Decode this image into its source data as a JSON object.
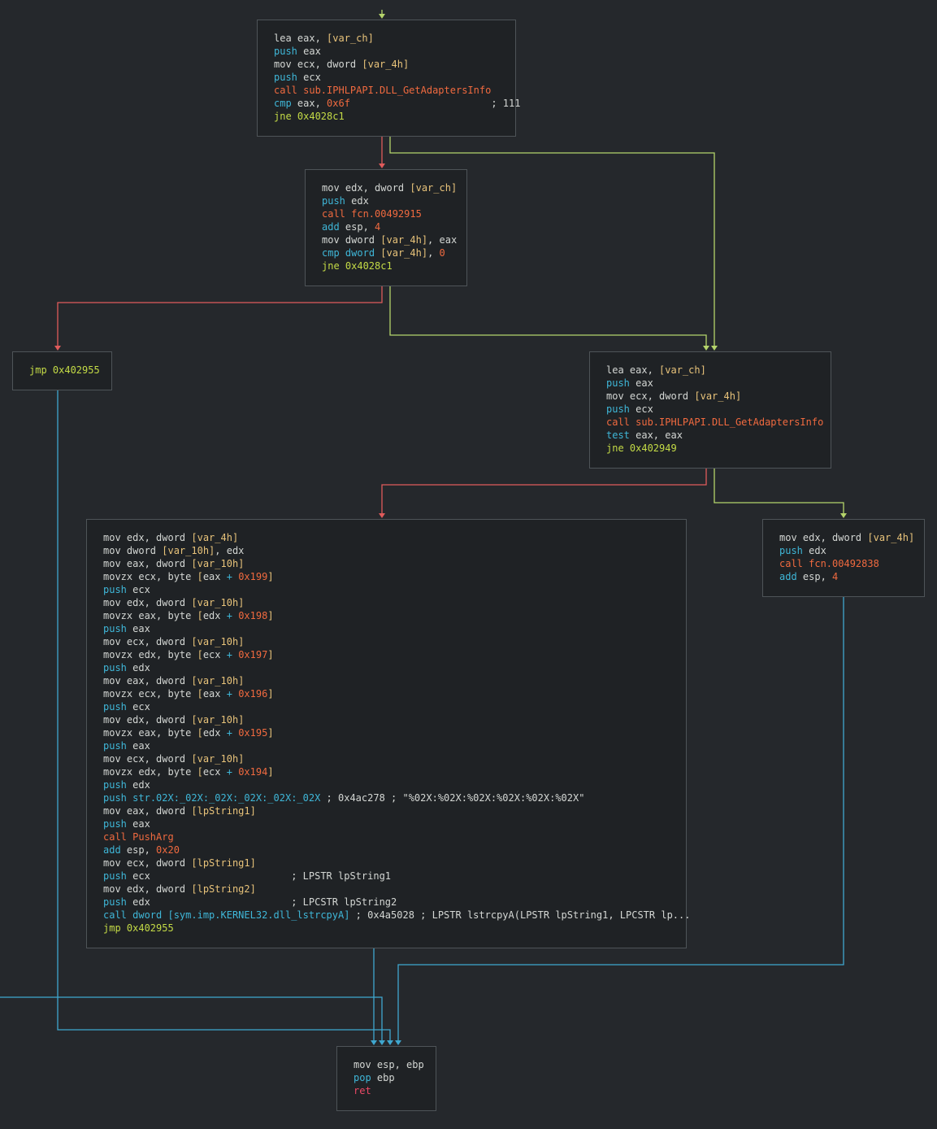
{
  "colors": {
    "background": "#25282c",
    "block_bg": "#1f2225",
    "block_border": "#4e5458",
    "edge_true": "#b5d46b",
    "edge_false": "#e05b5b",
    "edge_uncond": "#3fa7cf",
    "text": "#d4d7d4",
    "push_pop": "#3fb7d8",
    "call": "#f06a3f",
    "jump": "#c4db46",
    "var": "#e8c37a",
    "ret": "#ec4a66"
  },
  "blocks": [
    {
      "id": "b1",
      "lines": [
        [
          [
            "t-plain",
            "lea eax, "
          ],
          [
            "t-var",
            "[var_ch]"
          ]
        ],
        [
          [
            "t-push",
            "push"
          ],
          [
            "t-plain",
            " eax"
          ]
        ],
        [
          [
            "t-plain",
            "mov ecx, dword "
          ],
          [
            "t-var",
            "[var_4h]"
          ]
        ],
        [
          [
            "t-push",
            "push"
          ],
          [
            "t-plain",
            " ecx"
          ]
        ],
        [
          [
            "t-call",
            "call sub.IPHLPAPI.DLL_GetAdaptersInfo"
          ]
        ],
        [
          [
            "t-push",
            "cmp"
          ],
          [
            "t-plain",
            " eax, "
          ],
          [
            "t-num",
            "0x6f"
          ],
          [
            "t-cmt",
            "                        ; 111"
          ]
        ],
        [
          [
            "t-jmp",
            "jne 0x4028c1"
          ]
        ]
      ]
    },
    {
      "id": "b2",
      "lines": [
        [
          [
            "t-plain",
            "mov edx, dword "
          ],
          [
            "t-var",
            "[var_ch]"
          ]
        ],
        [
          [
            "t-push",
            "push"
          ],
          [
            "t-plain",
            " edx"
          ]
        ],
        [
          [
            "t-call",
            "call fcn.00492915"
          ]
        ],
        [
          [
            "t-push",
            "add"
          ],
          [
            "t-plain",
            " esp, "
          ],
          [
            "t-num",
            "4"
          ]
        ],
        [
          [
            "t-plain",
            "mov dword "
          ],
          [
            "t-var",
            "[var_4h]"
          ],
          [
            "t-plain",
            ", eax"
          ]
        ],
        [
          [
            "t-push",
            "cmp"
          ],
          [
            "t-plain",
            " "
          ],
          [
            "t-push",
            "dword"
          ],
          [
            "t-plain",
            " "
          ],
          [
            "t-var",
            "[var_4h]"
          ],
          [
            "t-plain",
            ", "
          ],
          [
            "t-num",
            "0"
          ]
        ],
        [
          [
            "t-jmp",
            "jne 0x4028c1"
          ]
        ]
      ]
    },
    {
      "id": "b3",
      "lines": [
        [
          [
            "t-jmp",
            "jmp 0x402955"
          ]
        ]
      ]
    },
    {
      "id": "b4",
      "lines": [
        [
          [
            "t-plain",
            "lea eax, "
          ],
          [
            "t-var",
            "[var_ch]"
          ]
        ],
        [
          [
            "t-push",
            "push"
          ],
          [
            "t-plain",
            " eax"
          ]
        ],
        [
          [
            "t-plain",
            "mov ecx, dword "
          ],
          [
            "t-var",
            "[var_4h]"
          ]
        ],
        [
          [
            "t-push",
            "push"
          ],
          [
            "t-plain",
            " ecx"
          ]
        ],
        [
          [
            "t-call",
            "call sub.IPHLPAPI.DLL_GetAdaptersInfo"
          ]
        ],
        [
          [
            "t-push",
            "test"
          ],
          [
            "t-plain",
            " eax, eax"
          ]
        ],
        [
          [
            "t-jmp",
            "jne 0x402949"
          ]
        ]
      ]
    },
    {
      "id": "b5",
      "lines": [
        [
          [
            "t-plain",
            "mov edx, dword "
          ],
          [
            "t-var",
            "[var_4h]"
          ]
        ],
        [
          [
            "t-plain",
            "mov dword "
          ],
          [
            "t-var",
            "[var_10h]"
          ],
          [
            "t-plain",
            ", edx"
          ]
        ],
        [
          [
            "t-plain",
            "mov eax, dword "
          ],
          [
            "t-var",
            "[var_10h]"
          ]
        ],
        [
          [
            "t-plain",
            "movzx ecx, byte "
          ],
          [
            "t-var",
            "["
          ],
          [
            "t-plain",
            "eax "
          ],
          [
            "t-push",
            "+"
          ],
          [
            "t-plain",
            " "
          ],
          [
            "t-num",
            "0x199"
          ],
          [
            "t-var",
            "]"
          ]
        ],
        [
          [
            "t-push",
            "push"
          ],
          [
            "t-plain",
            " ecx"
          ]
        ],
        [
          [
            "t-plain",
            "mov edx, dword "
          ],
          [
            "t-var",
            "[var_10h]"
          ]
        ],
        [
          [
            "t-plain",
            "movzx eax, byte "
          ],
          [
            "t-var",
            "["
          ],
          [
            "t-plain",
            "edx "
          ],
          [
            "t-push",
            "+"
          ],
          [
            "t-plain",
            " "
          ],
          [
            "t-num",
            "0x198"
          ],
          [
            "t-var",
            "]"
          ]
        ],
        [
          [
            "t-push",
            "push"
          ],
          [
            "t-plain",
            " eax"
          ]
        ],
        [
          [
            "t-plain",
            "mov ecx, dword "
          ],
          [
            "t-var",
            "[var_10h]"
          ]
        ],
        [
          [
            "t-plain",
            "movzx edx, byte "
          ],
          [
            "t-var",
            "["
          ],
          [
            "t-plain",
            "ecx "
          ],
          [
            "t-push",
            "+"
          ],
          [
            "t-plain",
            " "
          ],
          [
            "t-num",
            "0x197"
          ],
          [
            "t-var",
            "]"
          ]
        ],
        [
          [
            "t-push",
            "push"
          ],
          [
            "t-plain",
            " edx"
          ]
        ],
        [
          [
            "t-plain",
            "mov eax, dword "
          ],
          [
            "t-var",
            "[var_10h]"
          ]
        ],
        [
          [
            "t-plain",
            "movzx ecx, byte "
          ],
          [
            "t-var",
            "["
          ],
          [
            "t-plain",
            "eax "
          ],
          [
            "t-push",
            "+"
          ],
          [
            "t-plain",
            " "
          ],
          [
            "t-num",
            "0x196"
          ],
          [
            "t-var",
            "]"
          ]
        ],
        [
          [
            "t-push",
            "push"
          ],
          [
            "t-plain",
            " ecx"
          ]
        ],
        [
          [
            "t-plain",
            "mov edx, dword "
          ],
          [
            "t-var",
            "[var_10h]"
          ]
        ],
        [
          [
            "t-plain",
            "movzx eax, byte "
          ],
          [
            "t-var",
            "["
          ],
          [
            "t-plain",
            "edx "
          ],
          [
            "t-push",
            "+"
          ],
          [
            "t-plain",
            " "
          ],
          [
            "t-num",
            "0x195"
          ],
          [
            "t-var",
            "]"
          ]
        ],
        [
          [
            "t-push",
            "push"
          ],
          [
            "t-plain",
            " eax"
          ]
        ],
        [
          [
            "t-plain",
            "mov ecx, dword "
          ],
          [
            "t-var",
            "[var_10h]"
          ]
        ],
        [
          [
            "t-plain",
            "movzx edx, byte "
          ],
          [
            "t-var",
            "["
          ],
          [
            "t-plain",
            "ecx "
          ],
          [
            "t-push",
            "+"
          ],
          [
            "t-plain",
            " "
          ],
          [
            "t-num",
            "0x194"
          ],
          [
            "t-var",
            "]"
          ]
        ],
        [
          [
            "t-push",
            "push"
          ],
          [
            "t-plain",
            " edx"
          ]
        ],
        [
          [
            "t-push",
            "push"
          ],
          [
            "t-plain",
            " "
          ],
          [
            "t-str",
            "str.02X:_02X:_02X:_02X:_02X:_02X"
          ],
          [
            "t-cmt",
            " ; 0x4ac278 ; \"%02X:%02X:%02X:%02X:%02X:%02X\""
          ]
        ],
        [
          [
            "t-plain",
            "mov eax, dword "
          ],
          [
            "t-var",
            "[lpString1]"
          ]
        ],
        [
          [
            "t-push",
            "push"
          ],
          [
            "t-plain",
            " eax"
          ]
        ],
        [
          [
            "t-call",
            "call PushArg"
          ]
        ],
        [
          [
            "t-push",
            "add"
          ],
          [
            "t-plain",
            " esp, "
          ],
          [
            "t-num",
            "0x20"
          ]
        ],
        [
          [
            "t-plain",
            "mov ecx, dword "
          ],
          [
            "t-var",
            "[lpString1]"
          ]
        ],
        [
          [
            "t-push",
            "push"
          ],
          [
            "t-plain",
            " ecx"
          ],
          [
            "t-cmt",
            "                        ; LPSTR lpString1"
          ]
        ],
        [
          [
            "t-plain",
            "mov edx, dword "
          ],
          [
            "t-var",
            "[lpString2]"
          ]
        ],
        [
          [
            "t-push",
            "push"
          ],
          [
            "t-plain",
            " edx"
          ],
          [
            "t-cmt",
            "                        ; LPCSTR lpString2"
          ]
        ],
        [
          [
            "t-push",
            "call dword "
          ],
          [
            "t-str",
            "[sym.imp.KERNEL32.dll_lstrcpyA]"
          ],
          [
            "t-cmt",
            " ; 0x4a5028 ; LPSTR lstrcpyA(LPSTR lpString1, LPCSTR lp..."
          ]
        ],
        [
          [
            "t-jmp",
            "jmp 0x402955"
          ]
        ]
      ]
    },
    {
      "id": "b6",
      "lines": [
        [
          [
            "t-plain",
            "mov edx, dword "
          ],
          [
            "t-var",
            "[var_4h]"
          ]
        ],
        [
          [
            "t-push",
            "push"
          ],
          [
            "t-plain",
            " edx"
          ]
        ],
        [
          [
            "t-call",
            "call fcn.00492838"
          ]
        ],
        [
          [
            "t-push",
            "add"
          ],
          [
            "t-plain",
            " esp, "
          ],
          [
            "t-num",
            "4"
          ]
        ]
      ]
    },
    {
      "id": "b7",
      "lines": [
        [
          [
            "t-plain",
            "mov esp, ebp"
          ]
        ],
        [
          [
            "t-push",
            "pop"
          ],
          [
            "t-plain",
            " ebp"
          ]
        ],
        [
          [
            "t-ret",
            "ret"
          ]
        ]
      ]
    }
  ]
}
